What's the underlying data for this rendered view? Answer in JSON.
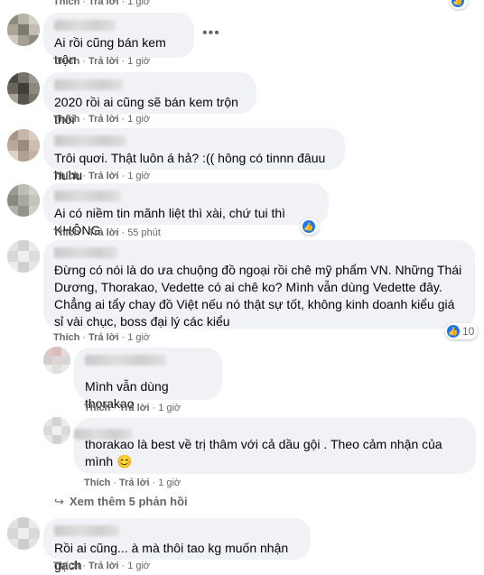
{
  "ui": {
    "like_label": "Thích",
    "reply_label": "Trả lời",
    "separator": "·",
    "more_icon": "more-horizontal-icon",
    "like_reaction_icon": "like-thumb-icon"
  },
  "top_actions": {
    "time": "1 giờ"
  },
  "comments": [
    {
      "text": "Ai rồi cũng bán kem trộn",
      "time": "1 giờ"
    },
    {
      "text": "2020 rồi ai cũng sẽ bán kem trộn thôi",
      "time": "1 giờ"
    },
    {
      "text": "Trôi quơi. Thật luôn á hả? :(( hông có tinnn đâuu huhu",
      "time": "1 giờ"
    },
    {
      "text": "Ai có niềm tin mãnh liệt thì xài, chứ tui thì KHÔNG.",
      "time": "55 phút"
    },
    {
      "text": "Đừng có nói là do ưa chuộng đồ ngoại rồi chê mỹ phẩm VN. Những Thái Dương, Thorakao, Vedette có ai chê ko? Mình vẫn dùng Vedette đây. Chẳng ai tẩy chay đồ Việt nếu nó thật sự tốt, không kinh doanh kiểu giá sỉ vài chục, boss đại lý các kiểu",
      "time": "1 giờ",
      "reactions": "10"
    },
    {
      "text": "Mình vẫn dùng thorakao",
      "time": "1 giờ"
    },
    {
      "text": "thorakao là best về trị thâm với cả dầu gội . Theo cảm nhận của mình 😊",
      "time": "1 giờ"
    },
    {
      "text": "Rồi ai cũng... à mà thôi tao kg muốn nhận gạch",
      "time": "1 giờ"
    }
  ],
  "view_more_replies": "Xem thêm 5 phản hồi"
}
